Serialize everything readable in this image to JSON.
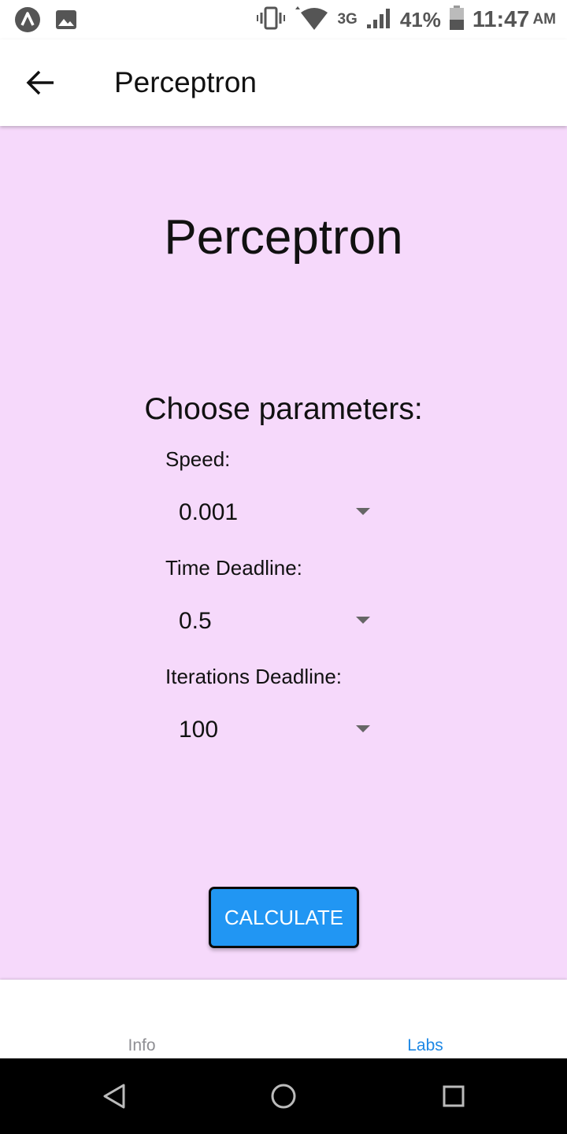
{
  "status_bar": {
    "network": "3G",
    "battery": "41%",
    "time": "11:47",
    "ampm": "AM",
    "icons": [
      "app-logo-icon",
      "image-icon",
      "vibrate-icon",
      "wifi-icon",
      "signal-icon",
      "battery-icon"
    ]
  },
  "app_bar": {
    "back_icon": "arrow-left-icon",
    "title": "Perceptron"
  },
  "main": {
    "title": "Perceptron",
    "section_title": "Choose parameters:",
    "fields": [
      {
        "label": "Speed:",
        "value": "0.001"
      },
      {
        "label": "Time Deadline:",
        "value": "0.5"
      },
      {
        "label": "Iterations Deadline:",
        "value": "100"
      }
    ],
    "button_label": "CALCULATE"
  },
  "tabs": [
    {
      "label": "Info",
      "active": false
    },
    {
      "label": "Labs",
      "active": true
    }
  ],
  "colors": {
    "content_background": "#f6d9fb",
    "button_background": "#2196f3",
    "active_tab": "#1e88e5",
    "inactive_tab": "#8e8e93"
  },
  "nav_bar": {
    "icons": [
      "nav-back-icon",
      "nav-home-icon",
      "nav-recents-icon"
    ]
  }
}
